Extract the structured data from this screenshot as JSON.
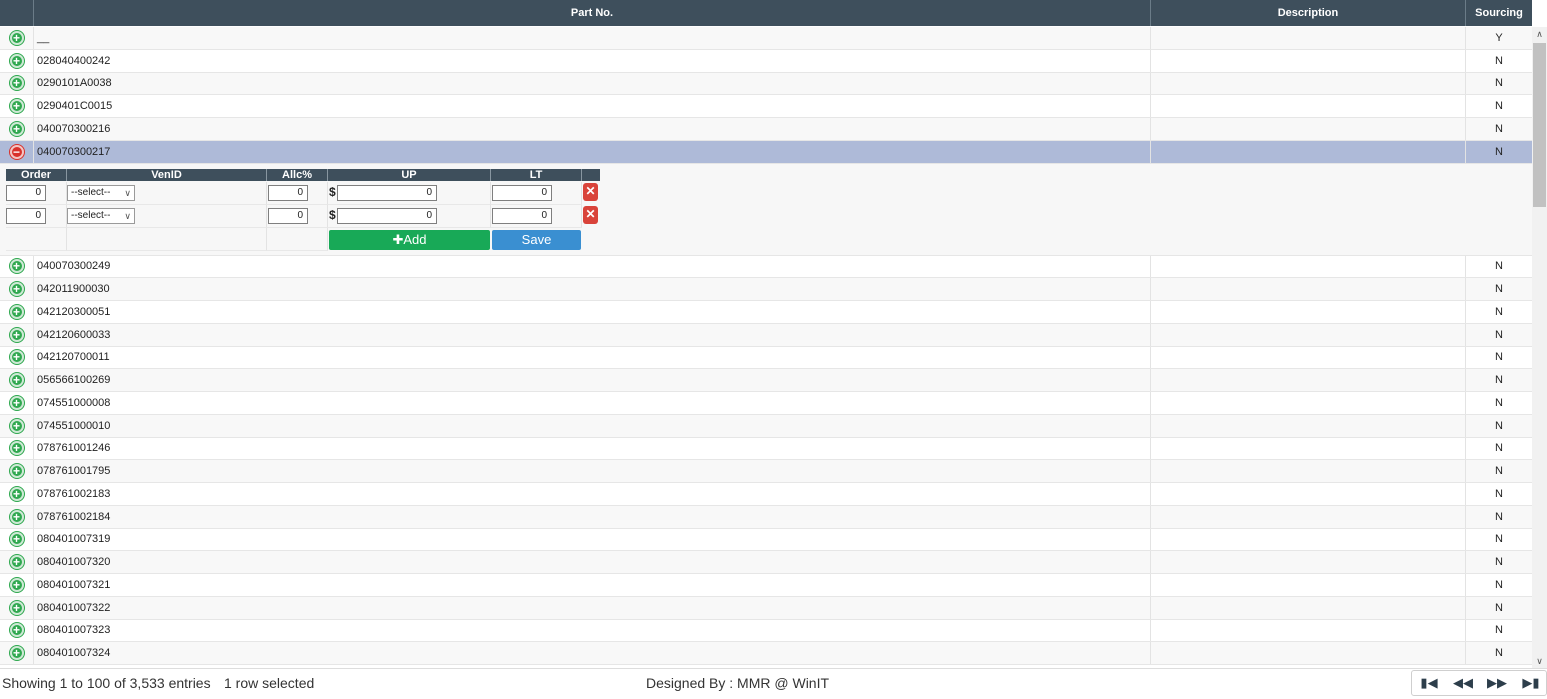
{
  "grid": {
    "headers": {
      "part": "Part No.",
      "description": "Description",
      "sourcing": "Sourcing"
    },
    "rows_before": [
      {
        "part": "__",
        "description": "",
        "sourcing": "Y"
      },
      {
        "part": "028040400242",
        "description": "",
        "sourcing": "N"
      },
      {
        "part": "0290101A0038",
        "description": "",
        "sourcing": "N"
      },
      {
        "part": "0290401C0015",
        "description": "",
        "sourcing": "N"
      },
      {
        "part": "040070300216",
        "description": "",
        "sourcing": "N"
      }
    ],
    "selected_row": {
      "part": "040070300217",
      "description": "",
      "sourcing": "N"
    },
    "rows_after": [
      {
        "part": "040070300249",
        "description": "",
        "sourcing": "N"
      },
      {
        "part": "042011900030",
        "description": "",
        "sourcing": "N"
      },
      {
        "part": "042120300051",
        "description": "",
        "sourcing": "N"
      },
      {
        "part": "042120600033",
        "description": "",
        "sourcing": "N"
      },
      {
        "part": "042120700011",
        "description": "",
        "sourcing": "N"
      },
      {
        "part": "056566100269",
        "description": "",
        "sourcing": "N"
      },
      {
        "part": "074551000008",
        "description": "",
        "sourcing": "N"
      },
      {
        "part": "074551000010",
        "description": "",
        "sourcing": "N"
      },
      {
        "part": "078761001246",
        "description": "",
        "sourcing": "N"
      },
      {
        "part": "078761001795",
        "description": "",
        "sourcing": "N"
      },
      {
        "part": "078761002183",
        "description": "",
        "sourcing": "N"
      },
      {
        "part": "078761002184",
        "description": "",
        "sourcing": "N"
      },
      {
        "part": "080401007319",
        "description": "",
        "sourcing": "N"
      },
      {
        "part": "080401007320",
        "description": "",
        "sourcing": "N"
      },
      {
        "part": "080401007321",
        "description": "",
        "sourcing": "N"
      },
      {
        "part": "080401007322",
        "description": "",
        "sourcing": "N"
      },
      {
        "part": "080401007323",
        "description": "",
        "sourcing": "N"
      },
      {
        "part": "080401007324",
        "description": "",
        "sourcing": "N"
      }
    ]
  },
  "detail": {
    "headers": {
      "order": "Order",
      "venid": "VenID",
      "allc": "Allc%",
      "up": "UP",
      "lt": "LT"
    },
    "rows": [
      {
        "order": "0",
        "venid": "--select--",
        "allc": "0",
        "currency": "$",
        "up": "0",
        "lt": "0"
      },
      {
        "order": "0",
        "venid": "--select--",
        "allc": "0",
        "currency": "$",
        "up": "0",
        "lt": "0"
      }
    ],
    "add_label": "Add",
    "save_label": "Save"
  },
  "footer": {
    "info": "Showing 1 to 100 of 3,533 entries",
    "selected": "1 row selected",
    "designed_by": "Designed By : MMR @ WinIT"
  },
  "icons": {
    "expand": "plus-circle-icon",
    "collapse": "minus-circle-icon",
    "remove": "close-icon",
    "pager": [
      "first-page-icon",
      "previous-page-icon",
      "next-page-icon",
      "last-page-icon"
    ]
  },
  "colors": {
    "header_bg": "#3e4f5c",
    "selected_row": "#aebad8",
    "add_button": "#18a957",
    "save_button": "#3a8fd1",
    "remove_button": "#d9433a"
  }
}
